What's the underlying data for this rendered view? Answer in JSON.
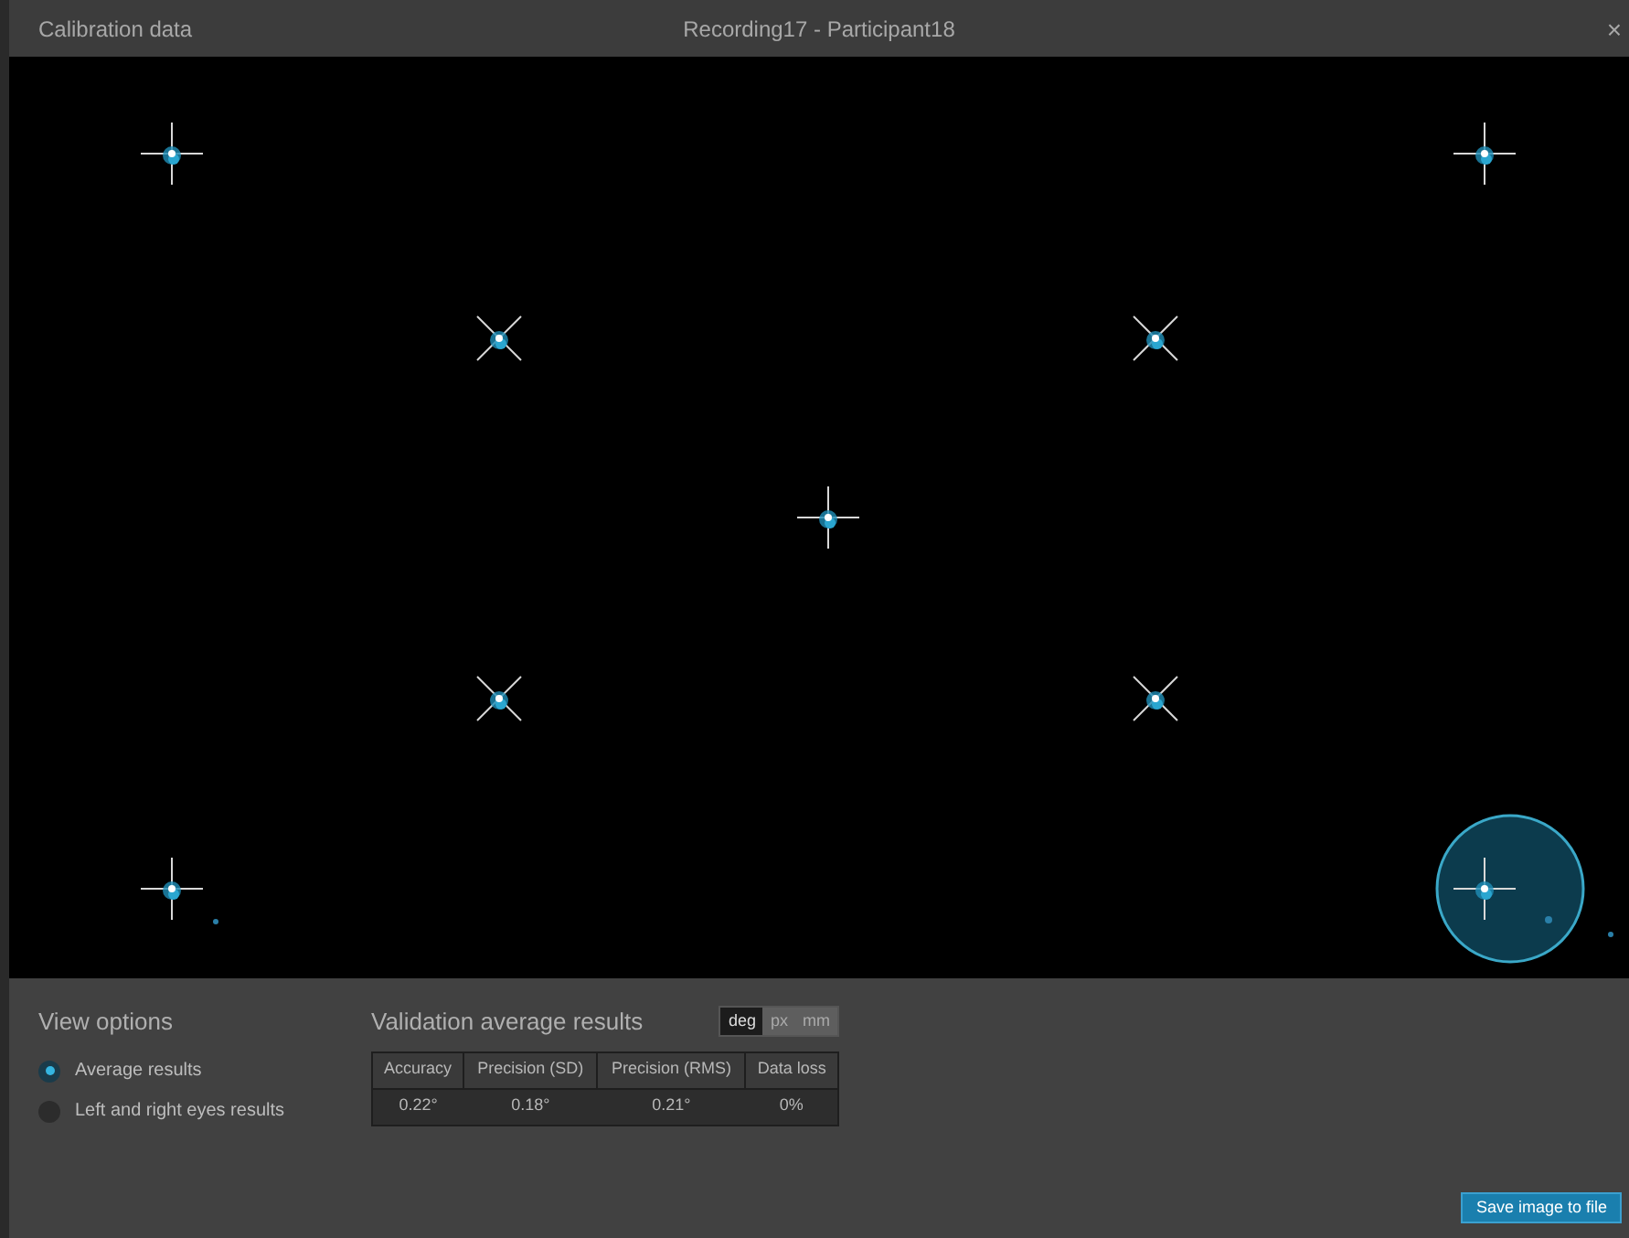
{
  "window": {
    "title": "Calibration data",
    "subtitle": "Recording17 - Participant18",
    "close": "×"
  },
  "view_options": {
    "title": "View options",
    "options": [
      {
        "label": "Average results",
        "selected": true
      },
      {
        "label": "Left and right eyes results",
        "selected": false
      }
    ]
  },
  "validation": {
    "title": "Validation average results",
    "units": [
      {
        "label": "deg",
        "selected": true
      },
      {
        "label": "px",
        "selected": false
      },
      {
        "label": "mm",
        "selected": false
      }
    ],
    "table": {
      "columns": [
        "Accuracy",
        "Precision (SD)",
        "Precision (RMS)",
        "Data loss"
      ],
      "rows": [
        [
          "0.22°",
          "0.18°",
          "0.21°",
          "0%"
        ]
      ]
    }
  },
  "save_button": "Save image to file"
}
